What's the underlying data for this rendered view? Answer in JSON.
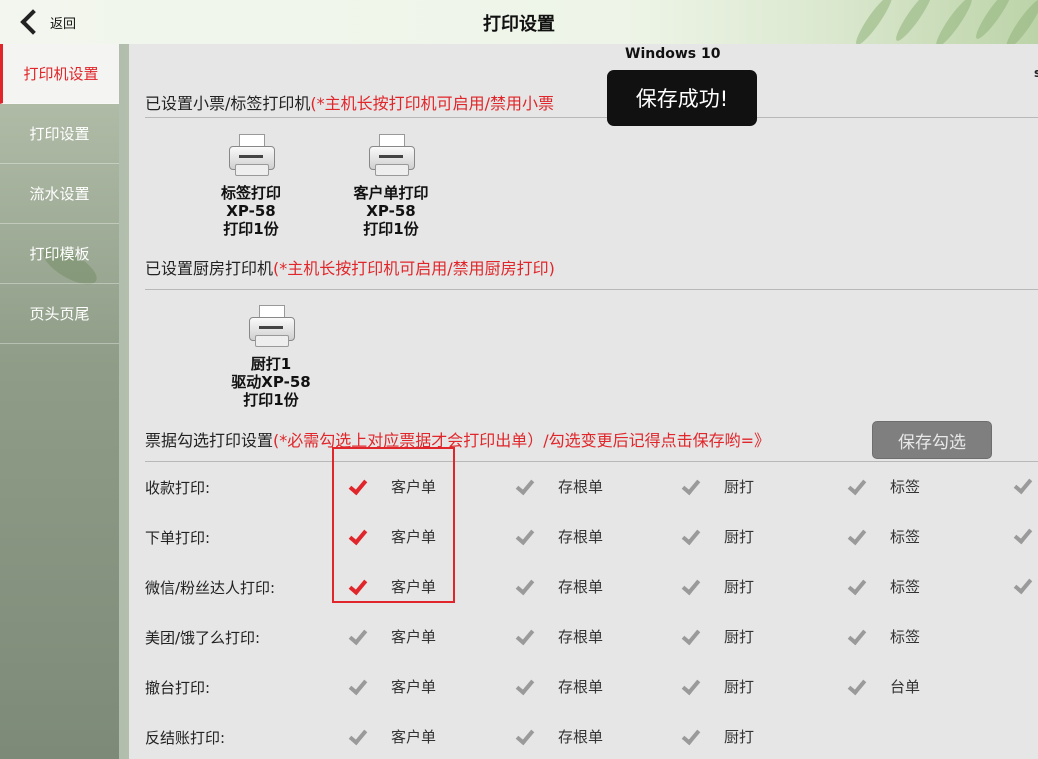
{
  "header": {
    "back_label": "返回",
    "title": "打印设置"
  },
  "sidebar": {
    "items": [
      {
        "label": "打印机设置",
        "active": true
      },
      {
        "label": "打印设置",
        "active": false
      },
      {
        "label": "流水设置",
        "active": false
      },
      {
        "label": "打印模板",
        "active": false
      },
      {
        "label": "页头页尾",
        "active": false
      }
    ]
  },
  "main": {
    "os_label": "Windows 10",
    "cut_text": "s",
    "ticket_section": {
      "title": "已设置小票/标签打印机",
      "hint": "(*主机长按打印机可启用/禁用小票"
    },
    "ticket_printers": [
      {
        "name": "标签打印",
        "model": "XP-58",
        "copies": "打印1份"
      },
      {
        "name": "客户单打印",
        "model": "XP-58",
        "copies": "打印1份"
      }
    ],
    "kitchen_section": {
      "title": "已设置厨房打印机",
      "hint": "(*主机长按打印机可启用/禁用厨房打印)"
    },
    "kitchen_printers": [
      {
        "name": "厨打1",
        "model": "驱动XP-58",
        "copies": "打印1份"
      }
    ],
    "receipt_section": {
      "title": "票据勾选打印设置",
      "hint": "(*必需勾选上对应票据才会打印出单）/勾选变更后记得点击保存哟=》"
    },
    "save_button": "保存勾选",
    "rows": [
      {
        "label": "收款打印:",
        "options": [
          {
            "label": "客户单",
            "checked": true
          },
          {
            "label": "存根单",
            "checked": false
          },
          {
            "label": "厨打",
            "checked": false
          },
          {
            "label": "标签",
            "checked": false
          },
          {
            "label": "",
            "checked": false
          }
        ]
      },
      {
        "label": "下单打印:",
        "options": [
          {
            "label": "客户单",
            "checked": true
          },
          {
            "label": "存根单",
            "checked": false
          },
          {
            "label": "厨打",
            "checked": false
          },
          {
            "label": "标签",
            "checked": false
          },
          {
            "label": "",
            "checked": false
          }
        ]
      },
      {
        "label": "微信/粉丝达人打印:",
        "options": [
          {
            "label": "客户单",
            "checked": true
          },
          {
            "label": "存根单",
            "checked": false
          },
          {
            "label": "厨打",
            "checked": false
          },
          {
            "label": "标签",
            "checked": false
          },
          {
            "label": "",
            "checked": false
          }
        ]
      },
      {
        "label": "美团/饿了么打印:",
        "options": [
          {
            "label": "客户单",
            "checked": false
          },
          {
            "label": "存根单",
            "checked": false
          },
          {
            "label": "厨打",
            "checked": false
          },
          {
            "label": "标签",
            "checked": false
          }
        ]
      },
      {
        "label": "撤台打印:",
        "options": [
          {
            "label": "客户单",
            "checked": false
          },
          {
            "label": "存根单",
            "checked": false
          },
          {
            "label": "厨打",
            "checked": false
          },
          {
            "label": "台单",
            "checked": false
          }
        ]
      },
      {
        "label": "反结账打印:",
        "options": [
          {
            "label": "客户单",
            "checked": false
          },
          {
            "label": "存根单",
            "checked": false
          },
          {
            "label": "厨打",
            "checked": false
          }
        ]
      }
    ]
  },
  "toast": {
    "message": "保存成功!"
  },
  "colors": {
    "accent_red": "#e0262a",
    "checked_red": "#e0262a",
    "unchecked_gray": "#9a9a9a",
    "toast_bg": "#111111"
  }
}
